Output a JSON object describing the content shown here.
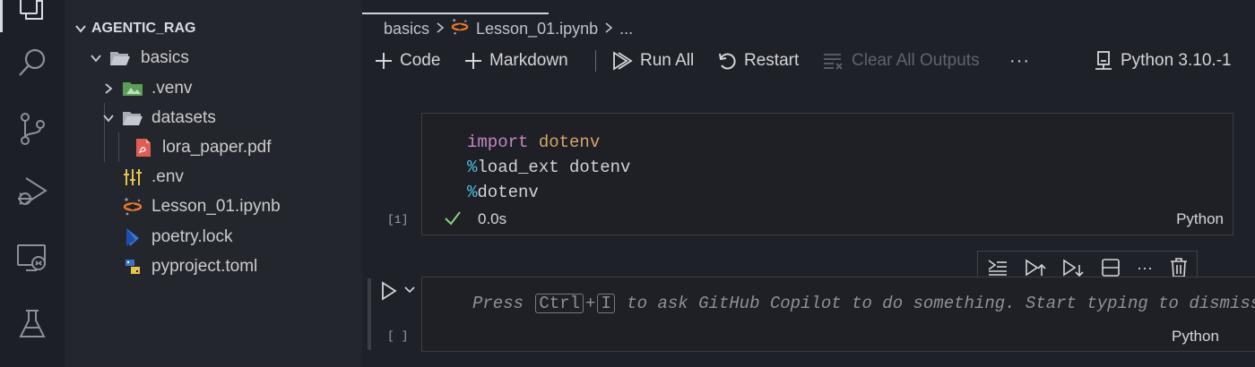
{
  "activity_bar": {
    "items": [
      {
        "name": "explorer",
        "icon": "files-icon"
      },
      {
        "name": "search",
        "icon": "search-icon"
      },
      {
        "name": "source-control",
        "icon": "source-control-icon"
      },
      {
        "name": "run-debug",
        "icon": "run-debug-icon"
      },
      {
        "name": "remote-explorer",
        "icon": "remote-explorer-icon"
      },
      {
        "name": "testing",
        "icon": "flask-icon"
      }
    ]
  },
  "explorer": {
    "root": "AGENTIC_RAG",
    "items": [
      {
        "label": "basics",
        "type": "folder-open"
      },
      {
        "label": ".venv",
        "type": "folder-closed"
      },
      {
        "label": "datasets",
        "type": "folder-open"
      },
      {
        "label": "lora_paper.pdf",
        "type": "pdf"
      },
      {
        "label": ".env",
        "type": "env"
      },
      {
        "label": "Lesson_01.ipynb",
        "type": "jupyter"
      },
      {
        "label": "poetry.lock",
        "type": "poetry"
      },
      {
        "label": "pyproject.toml",
        "type": "python"
      }
    ]
  },
  "breadcrumb": {
    "folder": "basics",
    "file": "Lesson_01.ipynb",
    "more": "..."
  },
  "toolbar": {
    "code_label": "Code",
    "markdown_label": "Markdown",
    "run_all_label": "Run All",
    "restart_label": "Restart",
    "clear_outputs_label": "Clear All Outputs",
    "more_label": "···",
    "kernel_label": "Python 3.10.-1"
  },
  "cells": [
    {
      "execution_count": "[1]",
      "code_lines": [
        {
          "keyword": "import",
          "rest": "dotenv"
        },
        {
          "magic": "%",
          "rest": "load_ext dotenv"
        },
        {
          "magic": "%",
          "rest": "dotenv"
        }
      ],
      "status": "0.0s",
      "language": "Python"
    },
    {
      "execution_count": "[ ]",
      "placeholder_pre": "Press",
      "key_ctrl": "Ctrl",
      "key_plus": "+",
      "key_i": "I",
      "placeholder_post": "to ask GitHub Copilot to do something. Start typing to dismiss.",
      "language": "Python"
    }
  ],
  "colors": {
    "keyword": "#c586c0",
    "module": "#d4a76a",
    "magic": "#4fc1e0",
    "success": "#89d185",
    "jupyter_orange": "#f37726"
  }
}
